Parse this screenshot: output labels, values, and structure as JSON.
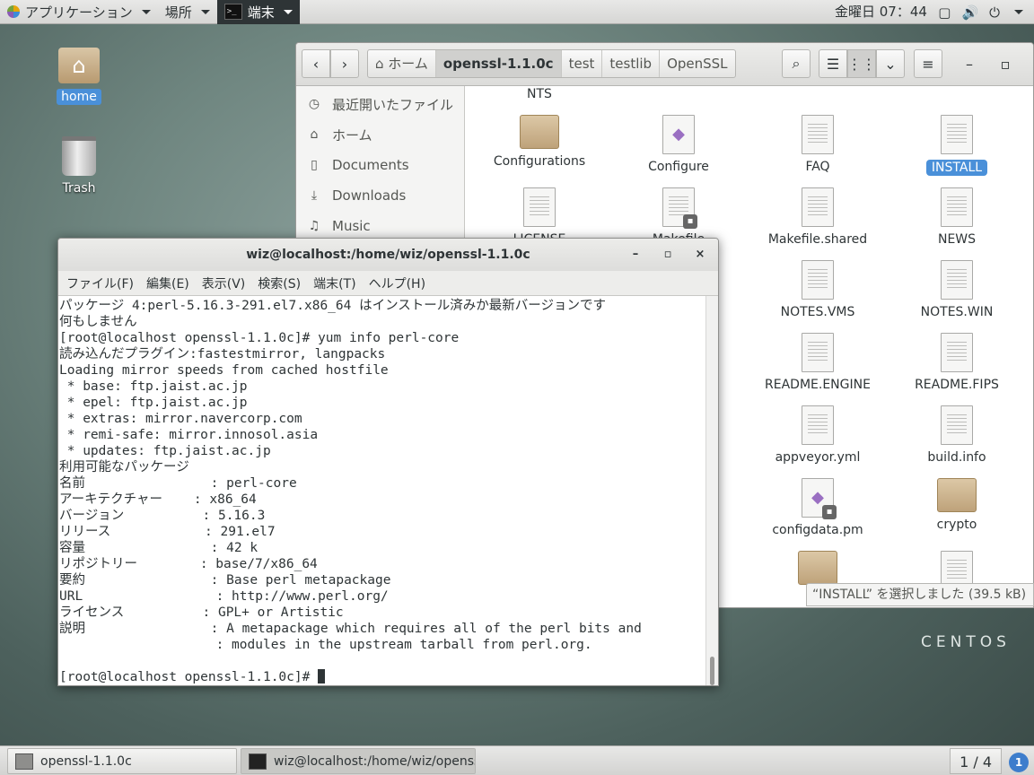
{
  "topbar": {
    "applications": "アプリケーション",
    "places": "場所",
    "terminal": "端末",
    "clock": "金曜日 07：44",
    "icons": [
      "window-icon",
      "volume-icon",
      "power-icon"
    ]
  },
  "desktop": {
    "home_label": "home",
    "trash_label": "Trash",
    "brand": "CENTOS"
  },
  "files": {
    "breadcrumbs": [
      "ホーム",
      "openssl-1.1.0c",
      "test",
      "testlib",
      "OpenSSL"
    ],
    "sidebar": [
      "最近開いたファイル",
      "ホーム",
      "Documents",
      "Downloads",
      "Music"
    ],
    "top_partial": "NTS",
    "items": [
      {
        "name": "Configurations",
        "kind": "folder"
      },
      {
        "name": "Configure",
        "kind": "script"
      },
      {
        "name": "FAQ",
        "kind": "doc"
      },
      {
        "name": "INSTALL",
        "kind": "doc",
        "selected": true
      },
      {
        "name": "LICENSE",
        "kind": "doc"
      },
      {
        "name": "Makefile",
        "kind": "lock"
      },
      {
        "name": "Makefile.shared",
        "kind": "doc"
      },
      {
        "name": "NEWS",
        "kind": "doc"
      },
      {
        "name": "NOTES.VMS",
        "kind": "doc"
      },
      {
        "name": "NOTES.WIN",
        "kind": "doc"
      },
      {
        "name": "README.ENGINE",
        "kind": "doc"
      },
      {
        "name": "README.FIPS",
        "kind": "doc"
      },
      {
        "name": "appveyor.yml",
        "kind": "doc"
      },
      {
        "name": "build.info",
        "kind": "doc"
      },
      {
        "name": "configdata.pm",
        "kind": "script-lock"
      },
      {
        "name": "crypto",
        "kind": "folder"
      }
    ],
    "status": "“INSTALL” を選択しました (39.5 kB)"
  },
  "terminal": {
    "title": "wiz@localhost:/home/wiz/openssl-1.1.0c",
    "menu": [
      "ファイル(F)",
      "編集(E)",
      "表示(V)",
      "検索(S)",
      "端末(T)",
      "ヘルプ(H)"
    ],
    "lines": [
      "パッケージ 4:perl-5.16.3-291.el7.x86_64 はインストール済みか最新バージョンです",
      "何もしません",
      "[root@localhost openssl-1.1.0c]# yum info perl-core",
      "読み込んだプラグイン:fastestmirror, langpacks",
      "Loading mirror speeds from cached hostfile",
      " * base: ftp.jaist.ac.jp",
      " * epel: ftp.jaist.ac.jp",
      " * extras: mirror.navercorp.com",
      " * remi-safe: mirror.innosol.asia",
      " * updates: ftp.jaist.ac.jp",
      "利用可能なパッケージ",
      "名前                : perl-core",
      "アーキテクチャー    : x86_64",
      "バージョン          : 5.16.3",
      "リリース            : 291.el7",
      "容量                : 42 k",
      "リポジトリー        : base/7/x86_64",
      "要約                : Base perl metapackage",
      "URL                 : http://www.perl.org/",
      "ライセンス          : GPL+ or Artistic",
      "説明                : A metapackage which requires all of the perl bits and",
      "                    : modules in the upstream tarball from perl.org.",
      ""
    ],
    "prompt": "[root@localhost openssl-1.1.0c]# "
  },
  "taskbar": {
    "tasks": [
      "openssl-1.1.0c",
      "wiz@localhost:/home/wiz/openss…"
    ],
    "workspace": "1 / 4",
    "notifications": "1"
  }
}
